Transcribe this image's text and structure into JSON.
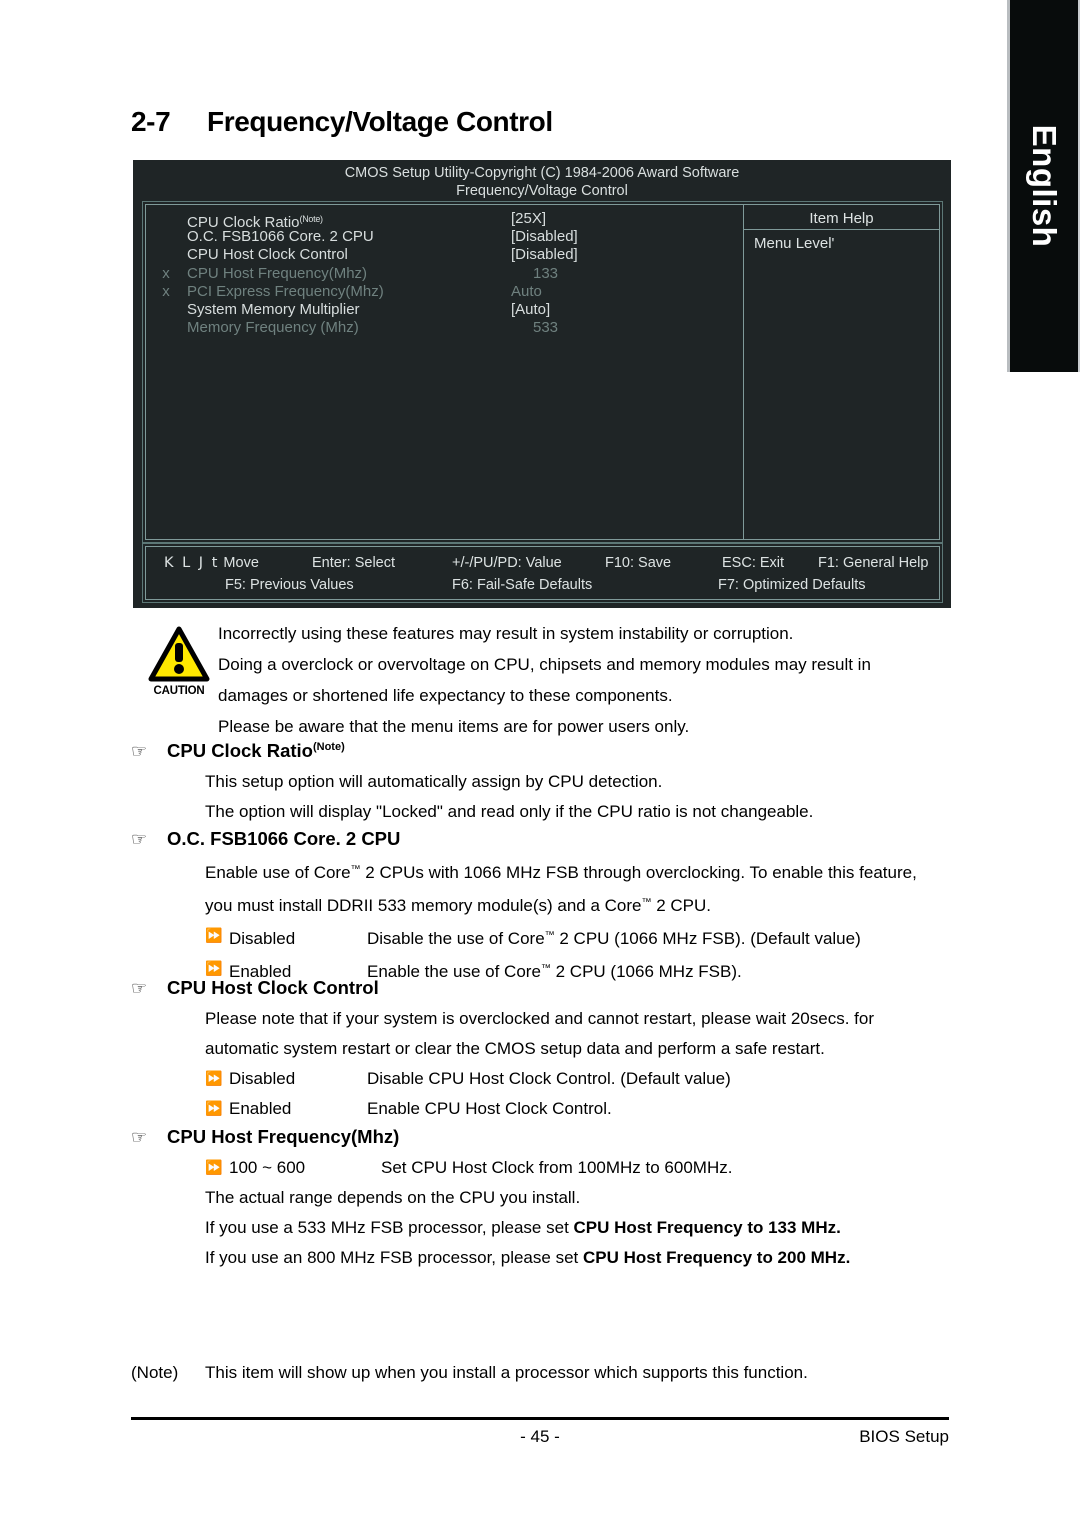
{
  "language_tab": {
    "label": "English"
  },
  "heading": {
    "number": "2-7",
    "title": "Frequency/Voltage Control"
  },
  "bios": {
    "title_line1": "CMOS Setup Utility-Copyright (C) 1984-2006 Award Software",
    "title_line2": "Frequency/Voltage Control",
    "help_title": "Item Help",
    "help_body": "Menu Level'",
    "rows": [
      {
        "x": "",
        "label": "CPU Clock Ratio",
        "sup": "(Note)",
        "value": "[25X]",
        "dim": false,
        "numeric": false
      },
      {
        "x": "",
        "label": "O.C. FSB1066 Core. 2 CPU",
        "sup": "",
        "value": "[Disabled]",
        "dim": false,
        "numeric": false
      },
      {
        "x": "",
        "label": "CPU Host Clock Control",
        "sup": "",
        "value": "[Disabled]",
        "dim": false,
        "numeric": false
      },
      {
        "x": "x",
        "label": "CPU Host Frequency(Mhz)",
        "sup": "",
        "value": "133",
        "dim": true,
        "numeric": true
      },
      {
        "x": "x",
        "label": "PCI Express Frequency(Mhz)",
        "sup": "",
        "value": "Auto",
        "dim": true,
        "numeric": false
      },
      {
        "x": "",
        "label": "System Memory Multiplier",
        "sup": "",
        "value": "[Auto]",
        "dim": false,
        "numeric": false
      },
      {
        "x": "",
        "label": "Memory Frequency (Mhz)",
        "sup": "",
        "value": "533",
        "dim": true,
        "numeric": true
      }
    ],
    "keys": {
      "move_arrows": "K L J t",
      "move": "Move",
      "enter": "Enter: Select",
      "value": "+/-/PU/PD: Value",
      "save": "F10: Save",
      "exit": "ESC: Exit",
      "general_help": "F1: General Help",
      "previous": "F5: Previous Values",
      "failsafe": "F6: Fail-Safe Defaults",
      "optimized": "F7: Optimized Defaults"
    }
  },
  "caution": {
    "icon_label": "CAUTION",
    "lines": [
      "Incorrectly using these features may result in system instability or corruption.",
      "Doing a overclock or overvoltage on CPU, chipsets and memory modules may result in",
      "damages or shortened life expectancy to these components.",
      "Please be aware that the menu items are for power users only."
    ]
  },
  "sections": {
    "cpu_clock_ratio": {
      "bullet": "☞",
      "heading": "CPU Clock Ratio",
      "heading_sup": "(Note)",
      "lines": [
        "This setup option will automatically assign by CPU detection.",
        "The option will display \"Locked\" and read only if the CPU ratio is not changeable."
      ]
    },
    "oc_fsb1066": {
      "bullet": "☞",
      "heading": "O.C. FSB1066 Core. 2 CPU",
      "para_line1": "Enable use of Core",
      "para_line1b": " 2 CPUs with 1066 MHz FSB through overclocking.  To enable this feature,",
      "para_line2a": "you must install DDRII 533 memory module(s) and a Core",
      "para_line2b": " 2 CPU.",
      "tm": "™",
      "options": [
        {
          "bullet": "⏩",
          "name": "Disabled",
          "desc_a": "Disable the use of Core",
          "desc_b": " 2 CPU (1066 MHz FSB). (Default value)"
        },
        {
          "bullet": "⏩",
          "name": "Enabled",
          "desc_a": "Enable the use of Core",
          "desc_b": " 2 CPU (1066 MHz FSB)."
        }
      ]
    },
    "cpu_host_clock_control": {
      "bullet": "☞",
      "heading": "CPU Host Clock Control",
      "lines": [
        "Please note that if your system is overclocked and cannot restart, please wait 20secs. for",
        "automatic system restart or clear the CMOS setup data and perform a safe restart."
      ],
      "options": [
        {
          "bullet": "⏩",
          "name": "Disabled",
          "desc": "Disable CPU Host Clock Control. (Default value)"
        },
        {
          "bullet": "⏩",
          "name": "Enabled",
          "desc": "Enable CPU Host Clock Control."
        }
      ]
    },
    "cpu_host_frequency": {
      "bullet": "☞",
      "heading": "CPU Host Frequency(Mhz)",
      "option": {
        "bullet": "⏩",
        "name": "100 ~ 600",
        "desc": "Set CPU Host Clock from 100MHz to 600MHz."
      },
      "line_range": "The actual range depends on the CPU you install.",
      "line_533_a": "If you use a 533 MHz FSB processor, please set ",
      "line_533_b": "CPU Host Frequency to 133 MHz.",
      "line_800_a": "If you use an 800 MHz FSB processor, please set ",
      "line_800_b": "CPU Host Frequency to 200 MHz."
    }
  },
  "footnote": {
    "tag": "(Note)",
    "text": "This item will show up when you install a processor which supports this function."
  },
  "footer": {
    "page_number": "- 45 -",
    "section_name": "BIOS Setup"
  }
}
